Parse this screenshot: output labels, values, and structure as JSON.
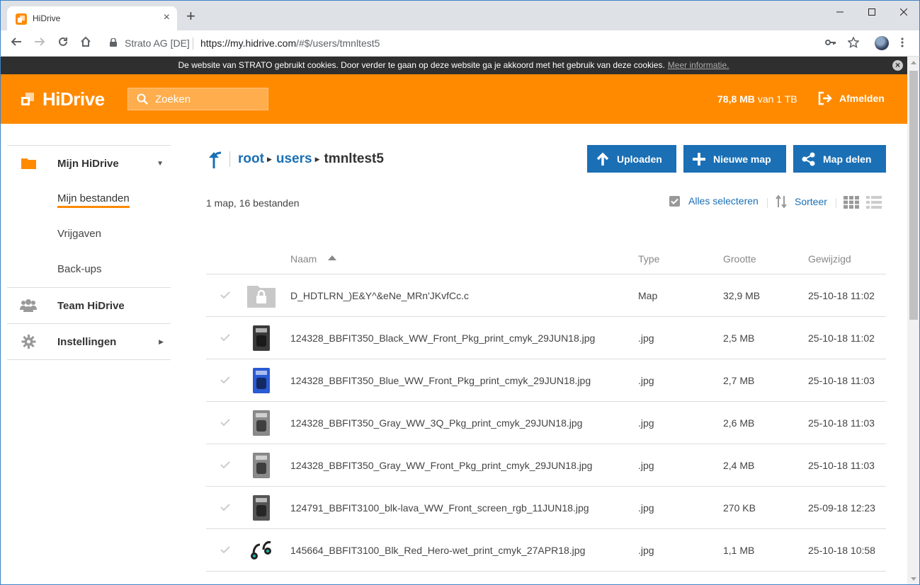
{
  "browser": {
    "tab_title": "HiDrive",
    "tab_close": "×",
    "new_tab": "+",
    "site_identity": "Strato AG [DE]",
    "url_host": "https://my.hidrive.com",
    "url_path": "/#$/users/tmnltest5"
  },
  "cookie": {
    "text": "De website van STRATO gebruikt cookies. Door verder te gaan op deze website ga je akkoord met het gebruik van deze cookies.",
    "link": "Meer informatie."
  },
  "header": {
    "logo": "HiDrive",
    "search_placeholder": "Zoeken",
    "storage_used": "78,8 MB",
    "storage_total": "van 1 TB",
    "logout": "Afmelden",
    "brand_color": "#ff8a00"
  },
  "sidebar": {
    "sections": [
      {
        "label": "Mijn HiDrive",
        "icon": "folder-icon"
      },
      {
        "label": "Team HiDrive",
        "icon": "team-icon"
      },
      {
        "label": "Instellingen",
        "icon": "gear-icon"
      }
    ],
    "sub_items": [
      "Mijn bestanden",
      "Vrijgaven",
      "Back-ups"
    ]
  },
  "breadcrumb": {
    "root": "root",
    "users": "users",
    "current": "tmnltest5"
  },
  "actions": {
    "upload": "Uploaden",
    "new_folder": "Nieuwe map",
    "share": "Map delen"
  },
  "summary": "1 map, 16 bestanden",
  "tools": {
    "select_all": "Alles selecteren",
    "sort": "Sorteer"
  },
  "table": {
    "columns": {
      "name": "Naam",
      "type": "Type",
      "size": "Grootte",
      "modified": "Gewijzigd"
    },
    "rows": [
      {
        "name": "D_HDTLRN_)E&Y^&eNe_MRn'JKvfCc.c",
        "type": "Map",
        "size": "32,9 MB",
        "modified": "25-10-18 11:02",
        "thumb": "folder-locked"
      },
      {
        "name": "124328_BBFIT350_Black_WW_Front_Pkg_print_cmyk_29JUN18.jpg",
        "type": ".jpg",
        "size": "2,5 MB",
        "modified": "25-10-18 11:02",
        "thumb": "#3a3a3a"
      },
      {
        "name": "124328_BBFIT350_Blue_WW_Front_Pkg_print_cmyk_29JUN18.jpg",
        "type": ".jpg",
        "size": "2,7 MB",
        "modified": "25-10-18 11:03",
        "thumb": "#2a5bd7"
      },
      {
        "name": "124328_BBFIT350_Gray_WW_3Q_Pkg_print_cmyk_29JUN18.jpg",
        "type": ".jpg",
        "size": "2,6 MB",
        "modified": "25-10-18 11:03",
        "thumb": "#8a8a8a"
      },
      {
        "name": "124328_BBFIT350_Gray_WW_Front_Pkg_print_cmyk_29JUN18.jpg",
        "type": ".jpg",
        "size": "2,4 MB",
        "modified": "25-10-18 11:03",
        "thumb": "#8a8a8a"
      },
      {
        "name": "124791_BBFIT3100_blk-lava_WW_Front_screen_rgb_11JUN18.jpg",
        "type": ".jpg",
        "size": "270 KB",
        "modified": "25-09-18 12:23",
        "thumb": "#555555"
      },
      {
        "name": "145664_BBFIT3100_Blk_Red_Hero-wet_print_cmyk_27APR18.jpg",
        "type": ".jpg",
        "size": "1,1 MB",
        "modified": "25-10-18 10:58",
        "thumb": "earbuds"
      }
    ]
  }
}
